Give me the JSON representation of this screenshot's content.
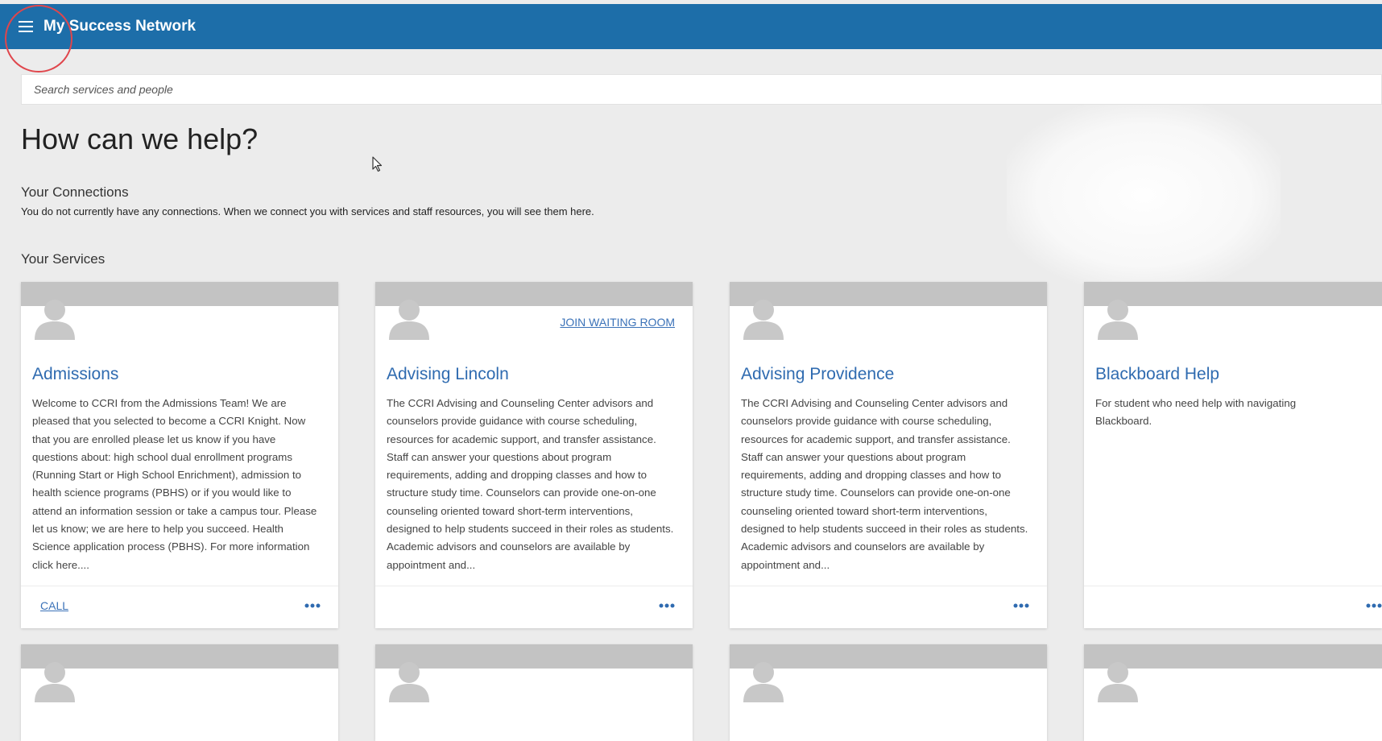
{
  "app": {
    "title": "My Success Network"
  },
  "search": {
    "placeholder": "Search services and people"
  },
  "page": {
    "heading": "How can we help?"
  },
  "connections": {
    "title": "Your Connections",
    "message": "You do not currently have any connections. When we connect you with services and staff resources, you will see them here."
  },
  "services": {
    "title": "Your Services",
    "cards": [
      {
        "title": "Admissions",
        "description": "Welcome to CCRI from the Admissions Team! We are pleased that you selected to become a CCRI Knight. Now that you are enrolled please let us know if you have questions about: high school dual enrollment programs (Running Start or High School Enrichment), admission to health science programs (PBHS) or if you would like to attend an information session or take a campus tour. Please let us know; we are here to help you succeed. Health Science application process (PBHS). For more information click here....",
        "action": "CALL",
        "menu": "•••"
      },
      {
        "title": "Advising Lincoln",
        "description": "The CCRI Advising and Counseling Center advisors and counselors provide guidance with course scheduling, resources for academic support, and transfer assistance. Staff can answer your questions about program requirements, adding and dropping classes and how to structure study time. Counselors can provide one-on-one counseling oriented toward short-term interventions, designed to help students succeed in their roles as students. Academic advisors and counselors are available by appointment and...",
        "link": "JOIN WAITING ROOM",
        "menu": "•••"
      },
      {
        "title": "Advising Providence",
        "description": "The CCRI Advising and Counseling Center advisors and counselors provide guidance with course scheduling, resources for academic support, and transfer assistance. Staff can answer your questions about program requirements, adding and dropping classes and how to structure study time. Counselors can provide one-on-one counseling oriented toward short-term interventions, designed to help students succeed in their roles as students. Academic advisors and counselors are available by appointment and...",
        "menu": "•••"
      },
      {
        "title": "Blackboard Help",
        "description": "For student who need help with navigating Blackboard.",
        "menu": "•••"
      }
    ]
  },
  "colors": {
    "topbar": "#1d6ea9",
    "link": "#3b72b8",
    "card_title": "#2f6bb0",
    "card_header": "#c3c3c3",
    "annotation": "#e0464c"
  },
  "icons": {
    "menu": "hamburger-menu-icon",
    "avatar": "person-silhouette-icon",
    "more": "ellipsis-horizontal-icon",
    "cursor": "mouse-pointer-icon"
  }
}
